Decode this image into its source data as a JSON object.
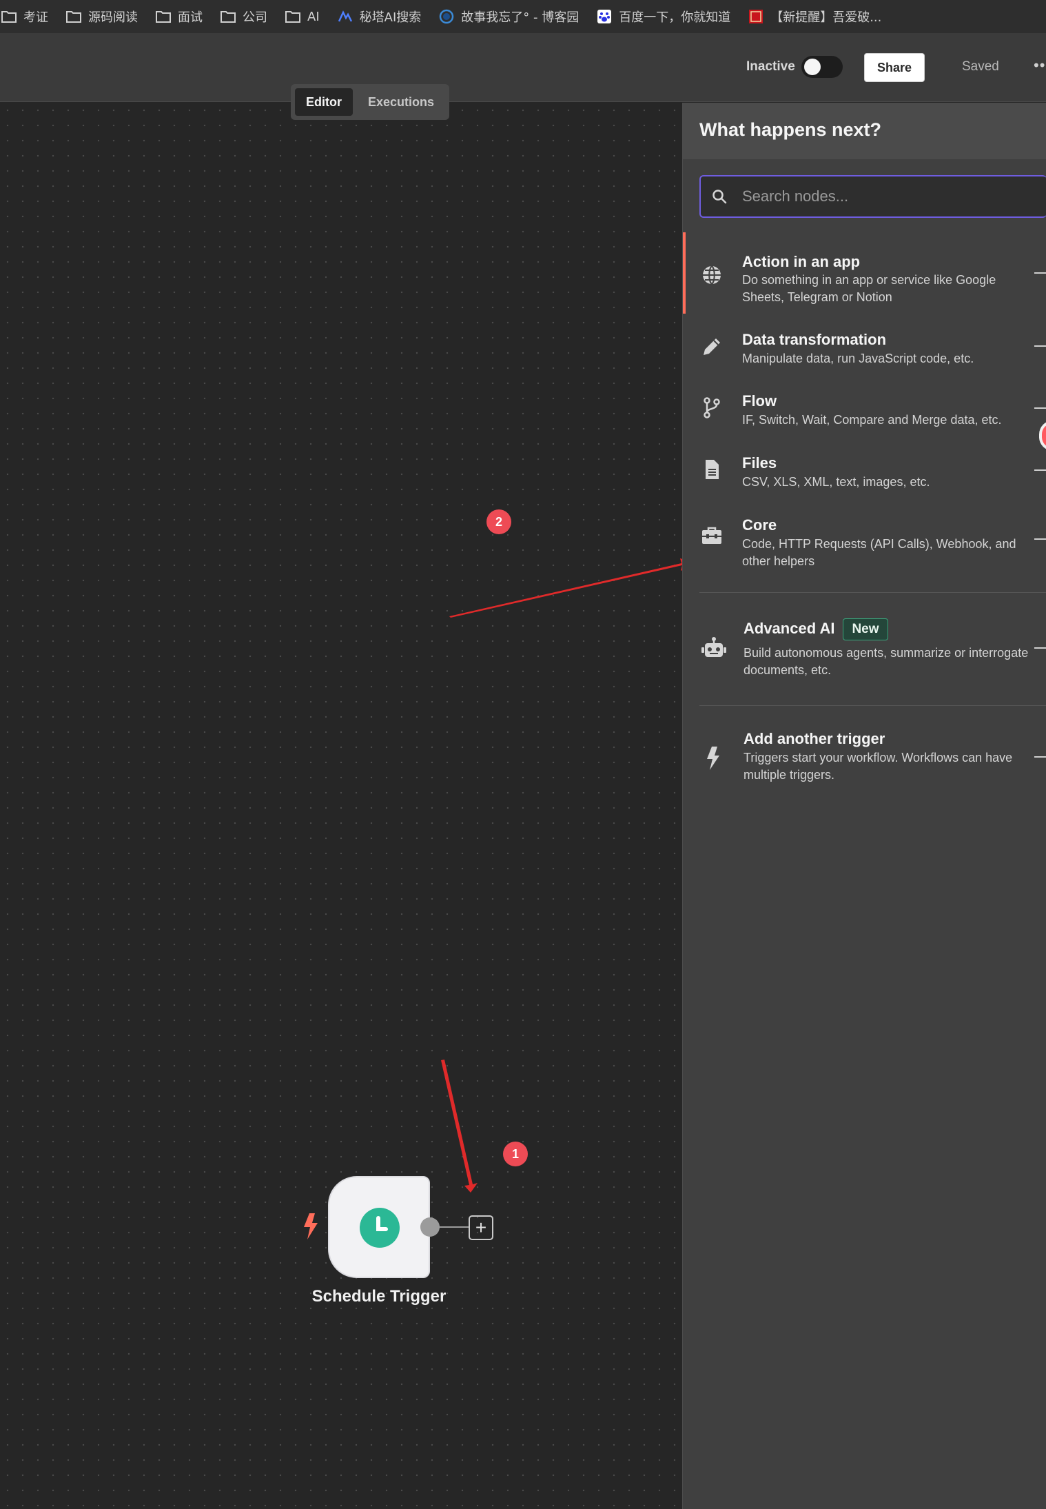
{
  "bookmarks": [
    {
      "label": "考证",
      "icon": "folder-icon"
    },
    {
      "label": "源码阅读",
      "icon": "folder-icon"
    },
    {
      "label": "面试",
      "icon": "folder-icon"
    },
    {
      "label": "公司",
      "icon": "folder-icon"
    },
    {
      "label": "AI",
      "icon": "folder-icon"
    },
    {
      "label": "秘塔AI搜索",
      "icon": "metaso-icon"
    },
    {
      "label": "故事我忘了° - 博客园",
      "icon": "cnblogs-icon"
    },
    {
      "label": "百度一下，你就知道",
      "icon": "baidu-icon"
    },
    {
      "label": "【新提醒】吾爱破...",
      "icon": "52pojie-icon"
    }
  ],
  "header": {
    "status": "Inactive",
    "share": "Share",
    "saved": "Saved",
    "more": "••"
  },
  "tabs": [
    {
      "label": "Editor",
      "active": true
    },
    {
      "label": "Executions",
      "active": false
    }
  ],
  "canvas": {
    "node": {
      "title": "Schedule Trigger",
      "icon": "clock-icon",
      "icon_color": "#2bb895"
    },
    "badges": [
      "1",
      "2"
    ],
    "annotation_color": "#e02a2a"
  },
  "panel": {
    "title": "What happens next?",
    "search_placeholder": "Search nodes...",
    "items": [
      {
        "title": "Action in an app",
        "desc": "Do something in an app or service like Google Sheets, Telegram or Notion",
        "icon": "globe-icon"
      },
      {
        "title": "Data transformation",
        "desc": "Manipulate data, run JavaScript code, etc.",
        "icon": "pencil-icon"
      },
      {
        "title": "Flow",
        "desc": "IF, Switch, Wait, Compare and Merge data, etc.",
        "icon": "branch-icon"
      },
      {
        "title": "Files",
        "desc": "CSV, XLS, XML, text, images, etc.",
        "icon": "file-icon"
      },
      {
        "title": "Core",
        "desc": "Code, HTTP Requests (API Calls), Webhook, and other helpers",
        "icon": "toolbox-icon"
      },
      {
        "title": "Advanced AI",
        "badge": "New",
        "desc": "Build autonomous agents, summarize or interrogate documents, etc.",
        "icon": "robot-icon"
      },
      {
        "title": "Add another trigger",
        "desc": "Triggers start your workflow. Workflows can have multiple triggers.",
        "icon": "bolt-icon"
      }
    ],
    "accent_color": "#ff6d5a",
    "new_badge_color": "#3aa37b"
  }
}
